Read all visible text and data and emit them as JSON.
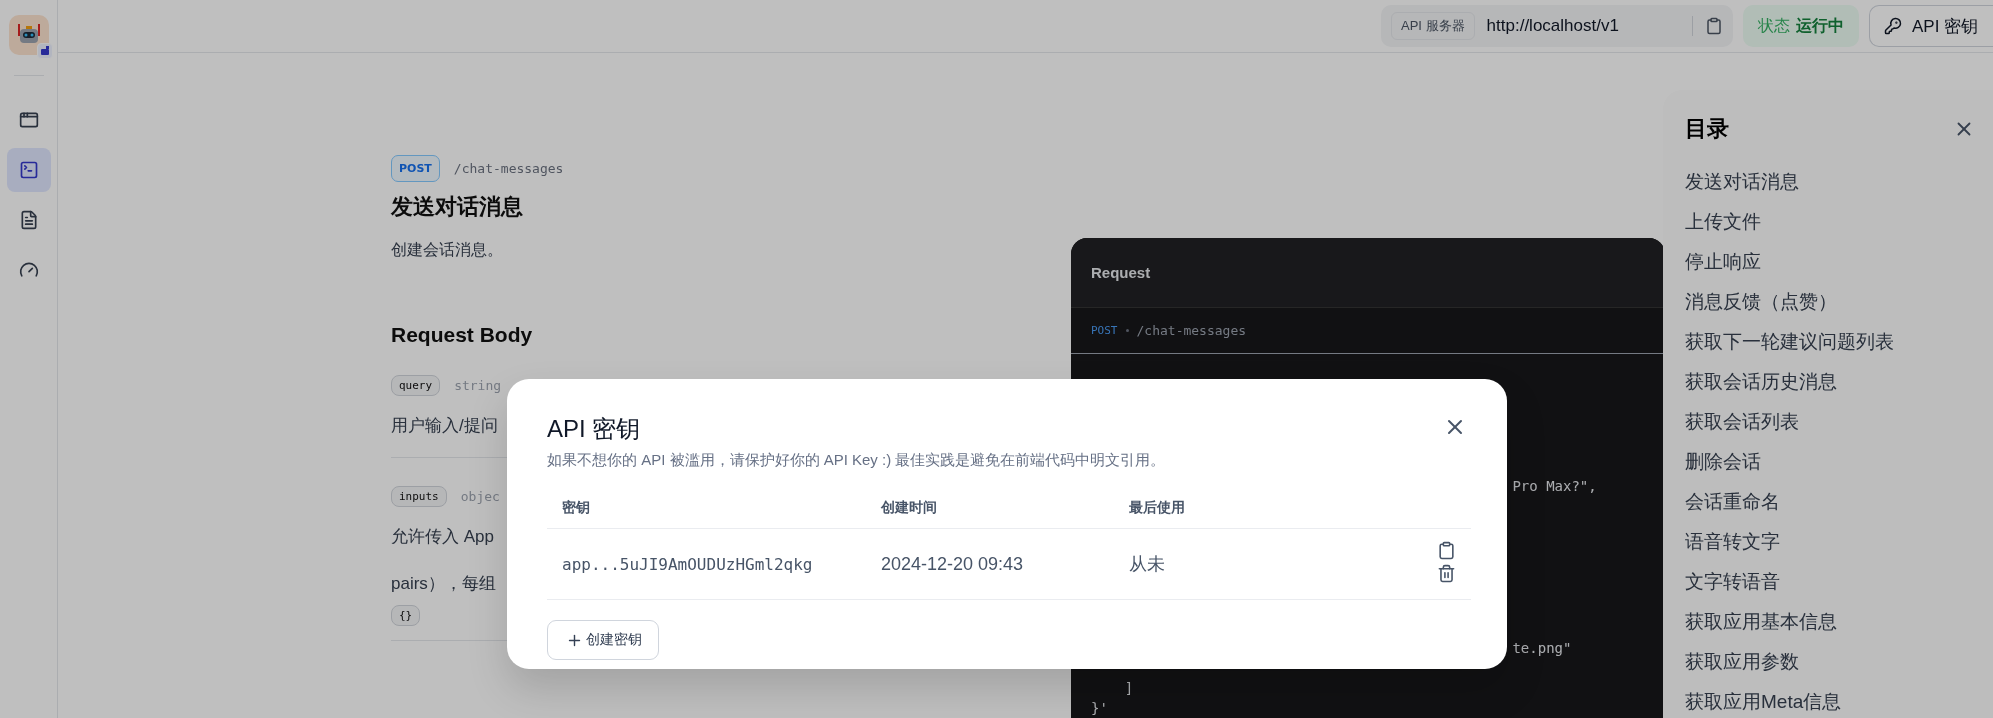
{
  "sidebar": {
    "items": [
      {
        "kind": "app",
        "selected": false
      },
      {
        "kind": "api",
        "selected": true
      },
      {
        "kind": "logs",
        "selected": false
      },
      {
        "kind": "monitor",
        "selected": false
      }
    ]
  },
  "topbar": {
    "server_label": "API 服务器",
    "server_url": "http://localhost/v1",
    "status_label": "状态",
    "status_value": "运行中",
    "api_key_button": "API 密钥"
  },
  "doc": {
    "method": "POST",
    "path": "/chat-messages",
    "title": "发送对话消息",
    "description": "创建会话消息。",
    "section_title": "Request Body",
    "params": [
      {
        "name": "query",
        "type": "string",
        "description": [
          "用户输入/提问"
        ]
      },
      {
        "name": "inputs",
        "type": "objec",
        "description": [
          "允许传入 App",
          "pairs），每组"
        ],
        "default": "{}"
      }
    ]
  },
  "code_panel": {
    "title": "Request",
    "method": "POST",
    "path": "/chat-messages",
    "lines": [
      "                                                  Pro Max?\",",
      "                                                  te.png\"",
      "    ]",
      "}'"
    ]
  },
  "toc": {
    "title": "目录",
    "items": [
      "发送对话消息",
      "上传文件",
      "停止响应",
      "消息反馈（点赞）",
      "获取下一轮建议问题列表",
      "获取会话历史消息",
      "获取会话列表",
      "删除会话",
      "会话重命名",
      "语音转文字",
      "文字转语音",
      "获取应用基本信息",
      "获取应用参数",
      "获取应用Meta信息"
    ]
  },
  "modal": {
    "title": "API 密钥",
    "description": "如果不想你的 API 被滥用，请保护好你的 API Key :) 最佳实践是避免在前端代码中明文引用。",
    "columns": [
      "密钥",
      "创建时间",
      "最后使用"
    ],
    "rows": [
      {
        "key": "app...5uJI9AmOUDUzHGml2qkg",
        "created": "2024-12-20 09:43",
        "last_used": "从未"
      }
    ],
    "create_button": "创建密钥"
  }
}
